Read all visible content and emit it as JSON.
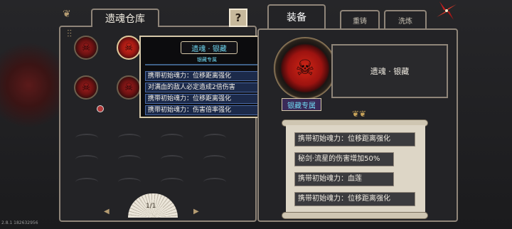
{
  "storage": {
    "title": "遗魂仓库",
    "help_label": "?",
    "page": "1/1"
  },
  "tooltip": {
    "name": "遗魂 · 银藏",
    "subtitle": "银藏专属",
    "rows": [
      "携带初始魂力：位移距离强化",
      "对满血的敌人必定造成2倍伤害",
      "携带初始魂力：位移距离强化",
      "携带初始魂力：伤害倍率强化"
    ]
  },
  "equipment": {
    "tabs": [
      {
        "label": "装备"
      },
      {
        "label": "重铸"
      },
      {
        "label": "洗炼"
      }
    ],
    "item_name": "遗魂 · 银藏",
    "badge": "银藏专属",
    "affixes": [
      "携带初始魂力：位移距离强化",
      "秘剑·流星的伤害增加50%",
      "携带初始魂力：血莲",
      "携带初始魂力：位移距离强化"
    ]
  },
  "version": "2.8.1 182632956",
  "colors": {
    "accent_cyan": "#6fd8f2",
    "frame": "#8f8579",
    "soul_red": "#d62b1c"
  }
}
